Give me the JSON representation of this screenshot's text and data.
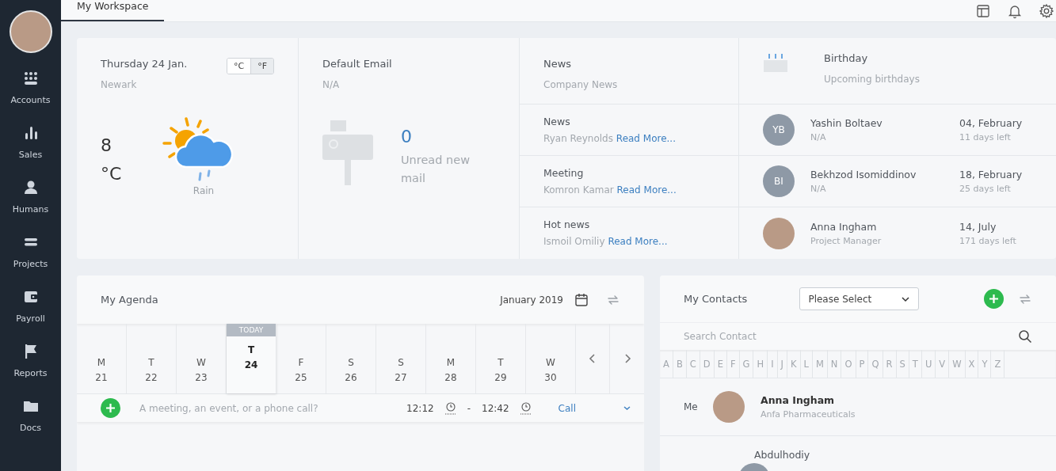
{
  "sidebar": {
    "items": [
      {
        "label": "Accounts"
      },
      {
        "label": "Sales"
      },
      {
        "label": "Humans"
      },
      {
        "label": "Projects"
      },
      {
        "label": "Payroll"
      },
      {
        "label": "Reports"
      },
      {
        "label": "Docs"
      }
    ]
  },
  "tabs": [
    {
      "label": "My Workspace",
      "selected": true
    }
  ],
  "weather": {
    "date": "Thursday 24 Jan.",
    "city": "Newark",
    "units": [
      {
        "label": "°C",
        "selected": false
      },
      {
        "label": "°F",
        "selected": true
      }
    ],
    "temperature": "8",
    "unit": "°C",
    "condition": "Rain"
  },
  "email": {
    "title": "Default Email",
    "address": "N/A",
    "count": "0",
    "caption": "Unread new mail"
  },
  "news": {
    "title": "News",
    "subtitle": "Company News",
    "items": [
      {
        "title": "News",
        "author": "Ryan Reynolds",
        "link": "Read More..."
      },
      {
        "title": "Meeting",
        "author": "Komron Kamar",
        "link": "Read More..."
      },
      {
        "title": "Hot news",
        "author": "Ismoil Omiliy",
        "link": "Read More..."
      }
    ]
  },
  "birthday": {
    "title": "Birthday",
    "subtitle": "Upcoming birthdays",
    "people": [
      {
        "kind": "initials",
        "initials": "YB",
        "name": "Yashin Boltaev",
        "role": "N/A",
        "date": "04, February",
        "left": "11 days left"
      },
      {
        "kind": "initials",
        "initials": "BI",
        "name": "Bekhzod Isomiddinov",
        "role": "N/A",
        "date": "18, February",
        "left": "25 days left"
      },
      {
        "kind": "photo",
        "name": "Anna Ingham",
        "role": "Project Manager",
        "date": "14, July",
        "left": "171 days left"
      }
    ]
  },
  "agenda": {
    "title": "My Agenda",
    "month": "January 2019",
    "today_label": "TODAY",
    "days": [
      {
        "weekday": "M",
        "day": "21",
        "selected": false
      },
      {
        "weekday": "T",
        "day": "22",
        "selected": false
      },
      {
        "weekday": "W",
        "day": "23",
        "selected": false
      },
      {
        "weekday": "T",
        "day": "24",
        "selected": true
      },
      {
        "weekday": "F",
        "day": "25",
        "selected": false
      },
      {
        "weekday": "S",
        "day": "26",
        "selected": false
      },
      {
        "weekday": "S",
        "day": "27",
        "selected": false
      },
      {
        "weekday": "M",
        "day": "28",
        "selected": false
      },
      {
        "weekday": "T",
        "day": "29",
        "selected": false
      },
      {
        "weekday": "W",
        "day": "30",
        "selected": false
      }
    ],
    "placeholder": "A meeting, an event, or a phone call?",
    "start": "12:12",
    "separator": "-",
    "end": "12:42",
    "type": "Call"
  },
  "contacts": {
    "title": "My Contacts",
    "filter": "Please Select",
    "search_placeholder": "Search Contact",
    "letters": [
      "A",
      "B",
      "C",
      "D",
      "E",
      "F",
      "G",
      "H",
      "I",
      "J",
      "K",
      "L",
      "M",
      "N",
      "O",
      "P",
      "Q",
      "R",
      "S",
      "T",
      "U",
      "V",
      "W",
      "X",
      "Y",
      "Z"
    ],
    "rows": [
      {
        "kind": "me",
        "tag": "Me",
        "name": "Anna Ingham",
        "company": "Anfa Pharmaceuticals"
      },
      {
        "kind": "other",
        "name": "Abdulhodiy"
      }
    ]
  }
}
